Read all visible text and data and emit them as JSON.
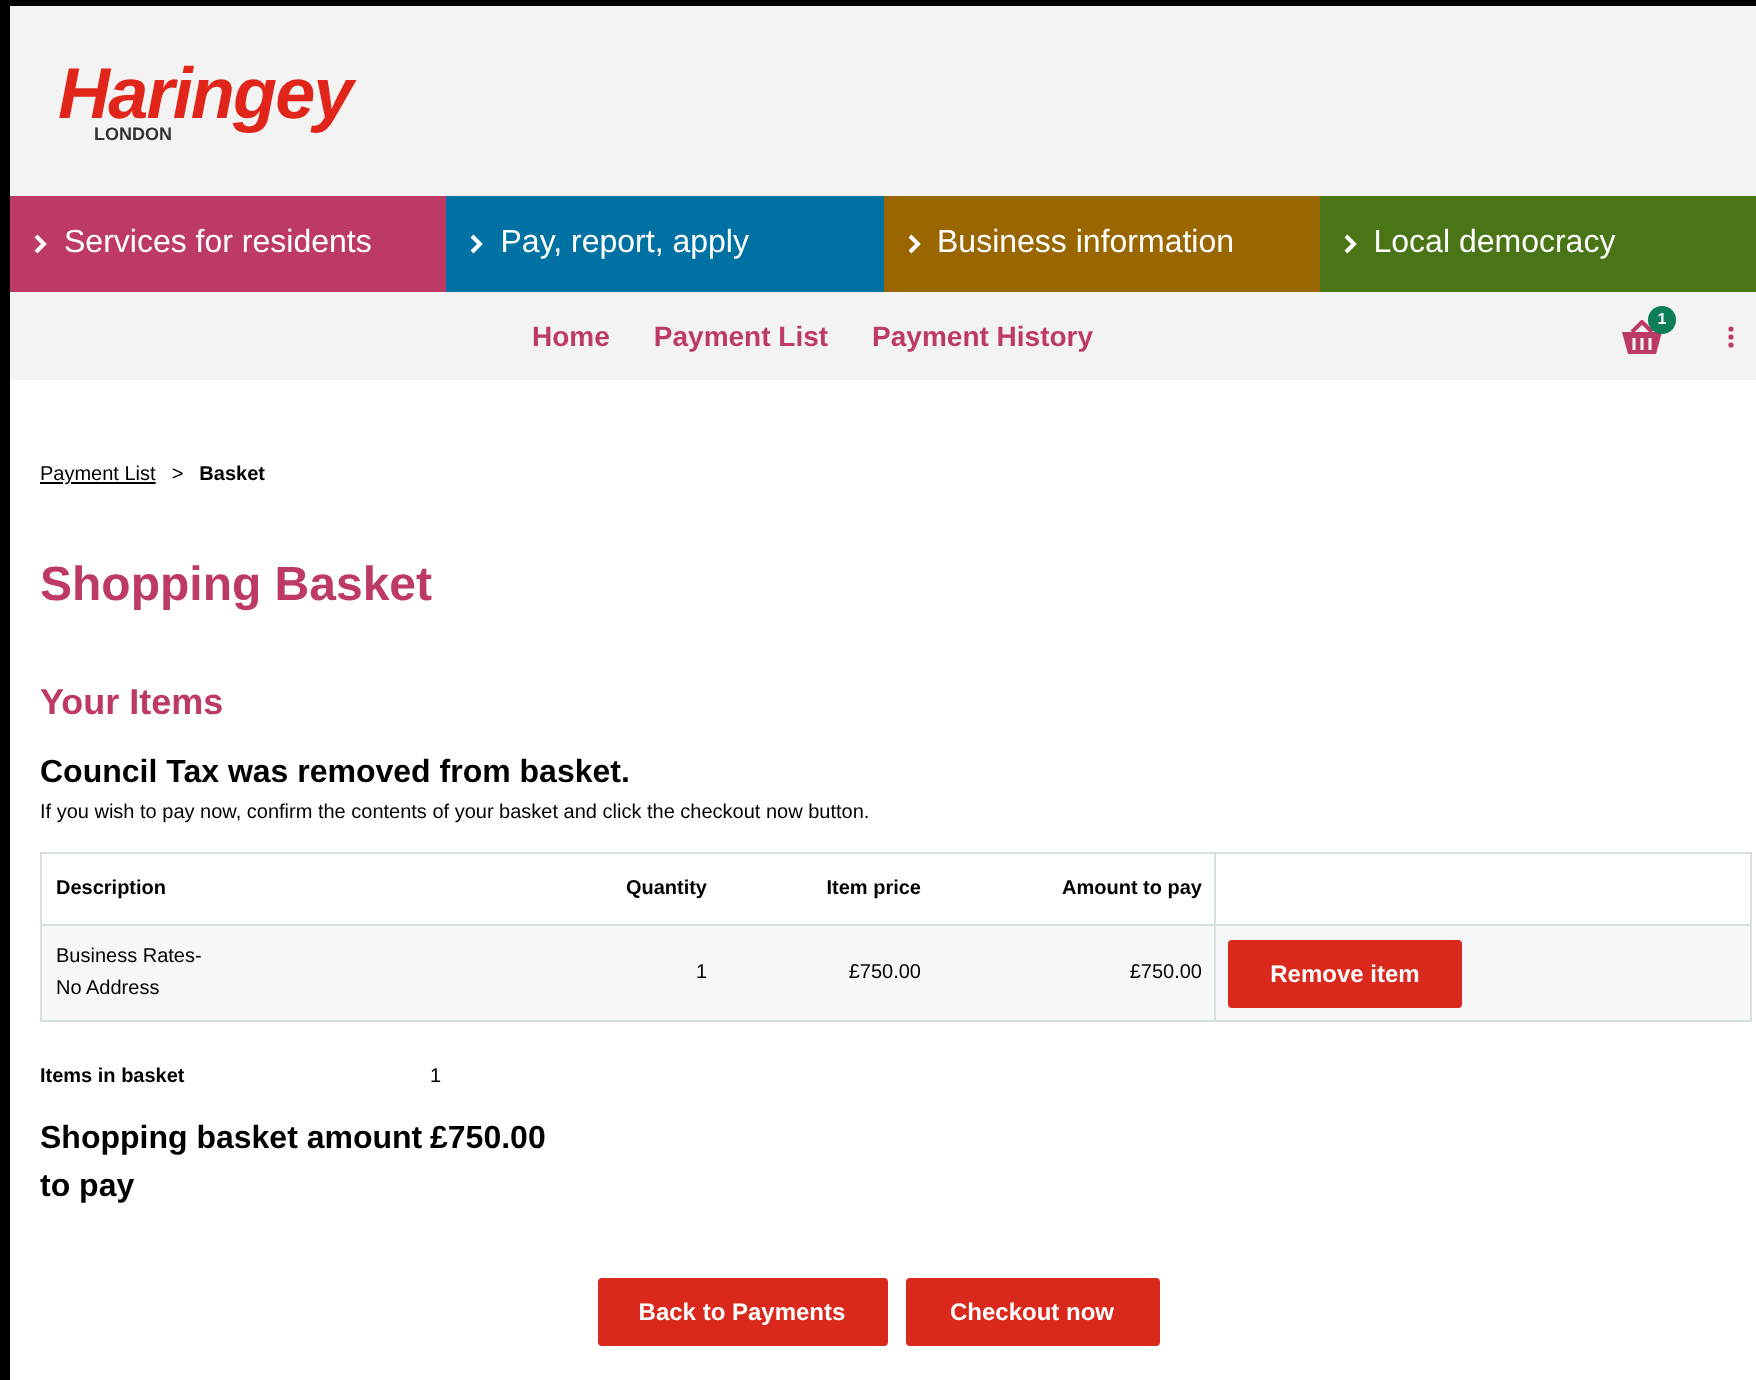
{
  "logo": {
    "name": "Haringey",
    "subtitle": "LONDON"
  },
  "main_nav": [
    {
      "label": "Services for residents",
      "color": "#be3a66"
    },
    {
      "label": "Pay, report, apply",
      "color": "#0071a3"
    },
    {
      "label": "Business information",
      "color": "#996600"
    },
    {
      "label": "Local democracy",
      "color": "#4a7516"
    }
  ],
  "sub_nav": [
    "Home",
    "Payment List",
    "Payment History"
  ],
  "basket_count": "1",
  "breadcrumb": {
    "link": "Payment List",
    "separator": ">",
    "current": "Basket"
  },
  "title": "Shopping Basket",
  "section_title": "Your Items",
  "message": "Council Tax was removed from basket.",
  "instructions": "If you wish to pay now, confirm the contents of your basket and click the checkout now button.",
  "table": {
    "columns": [
      "Description",
      "Quantity",
      "Item price",
      "Amount to pay"
    ],
    "rows": [
      {
        "description": [
          "Business Rates-",
          "No Address"
        ],
        "quantity": "1",
        "item_price": "£750.00",
        "amount": "£750.00",
        "action": "Remove item"
      }
    ]
  },
  "items_in_basket": {
    "label": "Items in basket",
    "value": "1"
  },
  "total": {
    "label": "Shopping basket amount to pay",
    "value": "£750.00"
  },
  "buttons": [
    "Back to Payments",
    "Checkout now"
  ]
}
